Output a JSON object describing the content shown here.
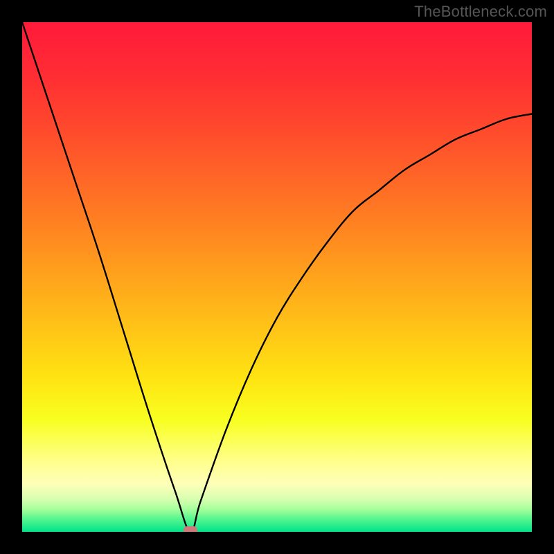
{
  "watermark": "TheBottleneck.com",
  "chart_data": {
    "type": "line",
    "title": "",
    "xlabel": "",
    "ylabel": "",
    "xlim": [
      0,
      100
    ],
    "ylim": [
      0,
      100
    ],
    "x_min_at": 33,
    "series": [
      {
        "name": "curve",
        "x": [
          0,
          5,
          10,
          15,
          20,
          25,
          30,
          33,
          35,
          40,
          45,
          50,
          55,
          60,
          65,
          70,
          75,
          80,
          85,
          90,
          95,
          100
        ],
        "y": [
          100,
          85,
          70,
          55,
          39,
          23,
          8,
          0,
          6,
          20,
          32,
          42,
          50,
          57,
          63,
          67,
          71,
          74,
          77,
          79,
          81,
          82
        ]
      }
    ],
    "annotations": [
      {
        "type": "marker",
        "x": 33,
        "y": 0,
        "shape": "rounded-rect",
        "color": "#cf7a7a"
      }
    ],
    "background_gradient": {
      "stops": [
        {
          "offset": 0.0,
          "color": "#ff1a3a"
        },
        {
          "offset": 0.1,
          "color": "#ff2c34"
        },
        {
          "offset": 0.2,
          "color": "#ff472d"
        },
        {
          "offset": 0.3,
          "color": "#ff6427"
        },
        {
          "offset": 0.4,
          "color": "#ff8321"
        },
        {
          "offset": 0.5,
          "color": "#ffa31c"
        },
        {
          "offset": 0.6,
          "color": "#ffc317"
        },
        {
          "offset": 0.7,
          "color": "#ffe412"
        },
        {
          "offset": 0.78,
          "color": "#f8ff20"
        },
        {
          "offset": 0.86,
          "color": "#ffff8a"
        },
        {
          "offset": 0.905,
          "color": "#ffffb8"
        },
        {
          "offset": 0.935,
          "color": "#d8ffb0"
        },
        {
          "offset": 0.955,
          "color": "#a8ff9c"
        },
        {
          "offset": 0.975,
          "color": "#55f58e"
        },
        {
          "offset": 1.0,
          "color": "#00e28a"
        }
      ]
    }
  }
}
